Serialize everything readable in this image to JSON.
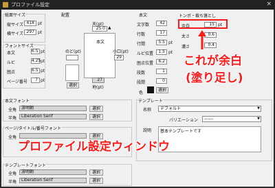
{
  "window": {
    "title": "プロファイル設定",
    "close_glyph": "×"
  },
  "paper": {
    "header": "紙面サイズ",
    "height_label": "縦サイズ",
    "height_value": "418",
    "width_label": "横サイズ",
    "width_value": "297",
    "unit": "pt"
  },
  "font_size": {
    "header": "フォントサイズ",
    "body_label": "本文",
    "body_value": "6.5",
    "ruby_label": "ルビ",
    "ruby_value": "4.25",
    "dot_label": "圏点",
    "dot_value": "6.5",
    "page_label": "ページ番号",
    "page_value": "7",
    "unit": "pt"
  },
  "layout": {
    "header": "配置",
    "top_label": "天(pt)",
    "top_value": "25.0",
    "body_label": "本文",
    "gutter_label": "のど(pt)",
    "mouth_label": "小口(pt)",
    "bottom_label": "地(pt)",
    "bottom_value": "27",
    "select_label": "選択",
    "mouth_value": "29"
  },
  "body": {
    "header": "本文",
    "chars_label": "文字数",
    "chars_value": "42",
    "lines_label": "行数",
    "lines_value": "17",
    "line_spacing_label": "行間",
    "line_spacing_value": "5.5",
    "ruby_pos_label": "ルビ位置",
    "ruby_pos_value": "1.5",
    "dot_pos_label": "圏点位置",
    "dot_pos_value": "6.2",
    "columns_label": "段数",
    "columns_value": "1",
    "column_gap_label": "段間",
    "column_gap_value": "0",
    "color_label": "色",
    "select_label": "選択",
    "unit": "pt"
  },
  "trim": {
    "header": "トンボ・裁ち落とし",
    "bleed_label": "余白",
    "bleed_value": "15",
    "thick_label": "太さ",
    "thick_value": "0.6",
    "outer_label": "濃さ",
    "outer_value": "0.4",
    "unit": "pt"
  },
  "callout": {
    "line1": "これが余白",
    "line2": "(塗り足し)",
    "title": "プロファイル設定ウィンドウ"
  },
  "body_font": {
    "header": "本文フォント",
    "fullwidth_label": "全角",
    "fullwidth_value": "游明朝",
    "halfwidth_label": "半角",
    "halfwidth_value": "Liberation Serif",
    "select_label": "選択"
  },
  "page_font": {
    "header": "ページ/タイトル/番号フォント",
    "fullwidth_label": "全角",
    "select_label": "選択"
  },
  "template": {
    "header": "テンプレート",
    "name_label": "名称",
    "name_value": "デフォルト",
    "variation_label": "バリエーション",
    "variation_value": "------",
    "desc_label": "説明",
    "desc_value": "基本テンプレートです"
  },
  "template_font": {
    "header": "テンプレートフォント",
    "fullwidth_label": "全角",
    "fullwidth_value": "游明朝",
    "halfwidth_label": "半角",
    "halfwidth_value": "Liberation Serif",
    "select_label": "選択"
  }
}
